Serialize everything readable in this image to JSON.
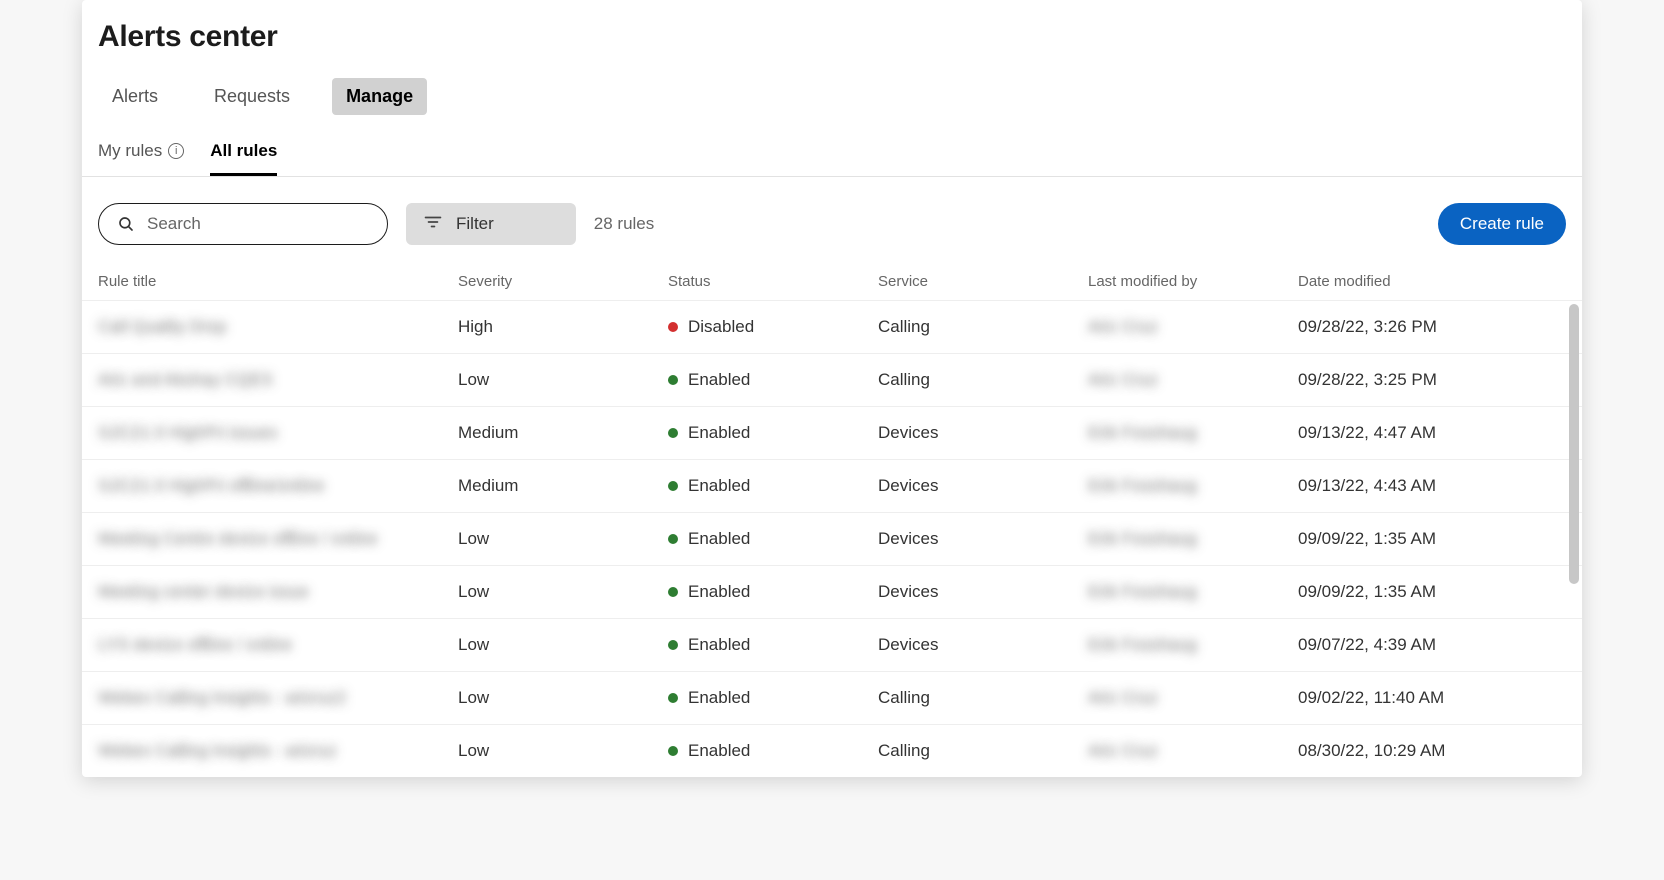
{
  "header": {
    "title": "Alerts center"
  },
  "tabs_top": [
    {
      "label": "Alerts",
      "active": false
    },
    {
      "label": "Requests",
      "active": false
    },
    {
      "label": "Manage",
      "active": true
    }
  ],
  "sub_tabs": [
    {
      "label": "My rules",
      "active": false,
      "info": true
    },
    {
      "label": "All rules",
      "active": true,
      "info": false
    }
  ],
  "toolbar": {
    "search_placeholder": "Search",
    "filter_label": "Filter",
    "count_label": "28 rules",
    "create_label": "Create rule"
  },
  "columns": {
    "rule_title": "Rule title",
    "severity": "Severity",
    "status": "Status",
    "service": "Service",
    "last_modified_by": "Last modified by",
    "date_modified": "Date modified"
  },
  "rows": [
    {
      "title": "Call Quality Drop",
      "severity": "High",
      "status": "Disabled",
      "status_color": "red",
      "service": "Calling",
      "modified_by": "Aric Cruz",
      "date": "09/28/22, 3:26 PM"
    },
    {
      "title": "Aric and Akshay CQES",
      "severity": "Low",
      "status": "Enabled",
      "status_color": "green",
      "service": "Calling",
      "modified_by": "Aric Cruz",
      "date": "09/28/22, 3:25 PM"
    },
    {
      "title": "SJC21-3 HighPri issues",
      "severity": "Medium",
      "status": "Enabled",
      "status_color": "green",
      "service": "Devices",
      "modified_by": "Erik Fosshaug",
      "date": "09/13/22, 4:47 AM"
    },
    {
      "title": "SJC21-3 HighPri offline/online",
      "severity": "Medium",
      "status": "Enabled",
      "status_color": "green",
      "service": "Devices",
      "modified_by": "Erik Fosshaug",
      "date": "09/13/22, 4:43 AM"
    },
    {
      "title": "Meeting Centre device offline / online",
      "severity": "Low",
      "status": "Enabled",
      "status_color": "green",
      "service": "Devices",
      "modified_by": "Erik Fosshaug",
      "date": "09/09/22, 1:35 AM"
    },
    {
      "title": "Meeting center device issue",
      "severity": "Low",
      "status": "Enabled",
      "status_color": "green",
      "service": "Devices",
      "modified_by": "Erik Fosshaug",
      "date": "09/09/22, 1:35 AM"
    },
    {
      "title": "LYS device offline / online",
      "severity": "Low",
      "status": "Enabled",
      "status_color": "green",
      "service": "Devices",
      "modified_by": "Erik Fosshaug",
      "date": "09/07/22, 4:39 AM"
    },
    {
      "title": "Webex Calling Insights - aricruz2",
      "severity": "Low",
      "status": "Enabled",
      "status_color": "green",
      "service": "Calling",
      "modified_by": "Aric Cruz",
      "date": "09/02/22, 11:40 AM"
    },
    {
      "title": "Webex Calling Insights - aricruz",
      "severity": "Low",
      "status": "Enabled",
      "status_color": "green",
      "service": "Calling",
      "modified_by": "Aric Cruz",
      "date": "08/30/22, 10:29 AM"
    }
  ]
}
